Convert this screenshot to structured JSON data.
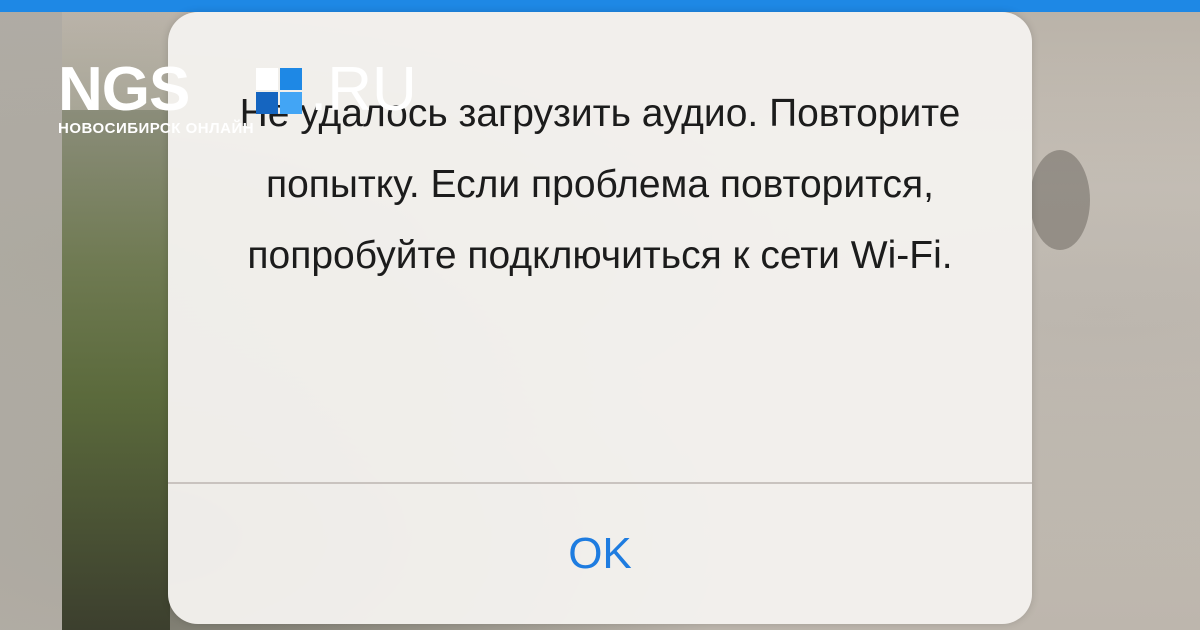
{
  "brand": {
    "name_main": "NGS",
    "name_tld": ".RU",
    "subtitle": "НОВОСИБИРСК ОНЛАЙН",
    "square_colors": [
      "#ffffff",
      "#1e88e5",
      "#1565c0",
      "#42a5f5"
    ],
    "accent_color": "#1e88e5"
  },
  "alert": {
    "message": "Не удалось загрузить аудио. Повторите попытку. Если проблема повторится, попробуйте подключиться к сети Wi-Fi.",
    "ok_label": "OK"
  }
}
